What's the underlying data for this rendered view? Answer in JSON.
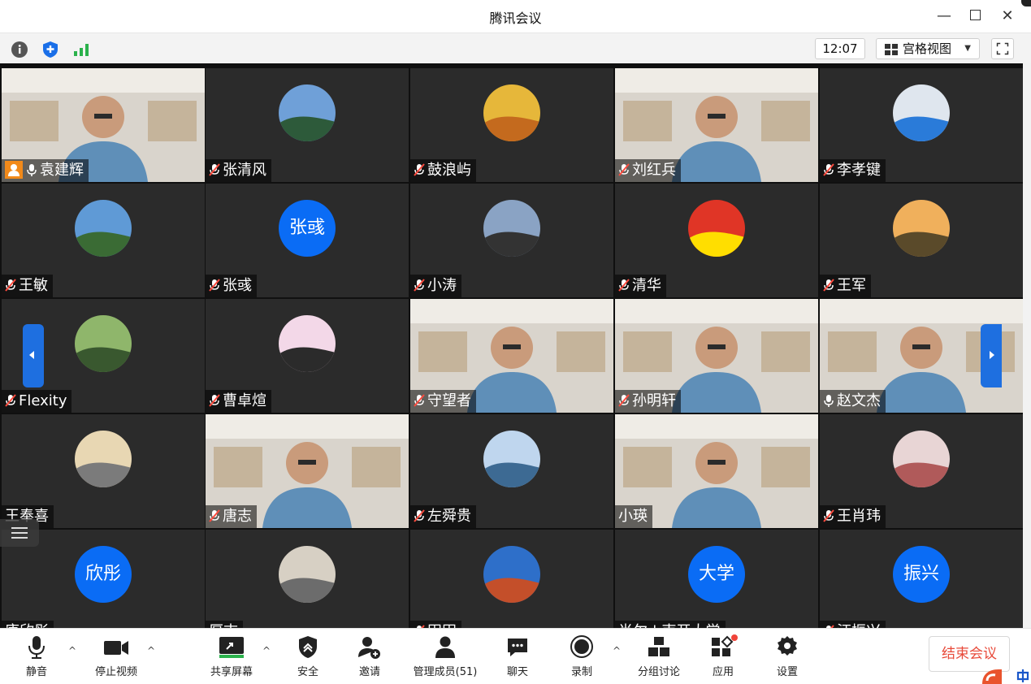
{
  "window": {
    "title": "腾讯会议",
    "minimize": "—",
    "close": "✕"
  },
  "infobar": {
    "time": "12:07",
    "view_label": "宫格视图",
    "view_caret": "▼"
  },
  "participants": [
    {
      "name": "袁建辉",
      "kind": "video",
      "mic": "on",
      "host": true
    },
    {
      "name": "张清风",
      "kind": "photo",
      "mic": "muted"
    },
    {
      "name": "鼓浪屿",
      "kind": "photo",
      "mic": "muted"
    },
    {
      "name": "刘红兵",
      "kind": "video",
      "mic": "muted"
    },
    {
      "name": "李孝键",
      "kind": "photo",
      "mic": "muted"
    },
    {
      "name": "王敏",
      "kind": "photo",
      "mic": "muted"
    },
    {
      "name": "张彧",
      "kind": "text",
      "avatar_text": "张彧",
      "mic": "muted"
    },
    {
      "name": "小涛",
      "kind": "photo",
      "mic": "muted"
    },
    {
      "name": "清华",
      "kind": "photo",
      "mic": "muted"
    },
    {
      "name": "王军",
      "kind": "photo",
      "mic": "muted"
    },
    {
      "name": "Flexity",
      "kind": "photo",
      "mic": "muted"
    },
    {
      "name": "曹卓煊",
      "kind": "photo",
      "mic": "muted"
    },
    {
      "name": "守望者",
      "kind": "video",
      "mic": "muted"
    },
    {
      "name": "孙明轩",
      "kind": "video",
      "mic": "muted"
    },
    {
      "name": "赵文杰",
      "kind": "video",
      "mic": "on",
      "active": true
    },
    {
      "name": "王奉喜",
      "kind": "photo",
      "mic": "none"
    },
    {
      "name": "唐志",
      "kind": "video",
      "mic": "muted"
    },
    {
      "name": "左舜贵",
      "kind": "photo",
      "mic": "muted"
    },
    {
      "name": "小瑛",
      "kind": "video",
      "mic": "none"
    },
    {
      "name": "王肖玮",
      "kind": "photo",
      "mic": "muted"
    },
    {
      "name": "康欣彤",
      "kind": "text",
      "avatar_text": "欣彤",
      "mic": "none"
    },
    {
      "name": "厚志",
      "kind": "photo",
      "mic": "none"
    },
    {
      "name": "田田",
      "kind": "photo",
      "mic": "muted"
    },
    {
      "name": "肖尔 | 南开大学",
      "kind": "text",
      "avatar_text": "大学",
      "mic": "none"
    },
    {
      "name": "汪振兴",
      "kind": "text",
      "avatar_text": "振兴",
      "mic": "muted"
    }
  ],
  "toolbar": {
    "mute": "静音",
    "stop_video": "停止视频",
    "share_screen": "共享屏幕",
    "security": "安全",
    "invite": "邀请",
    "manage_members": "管理成员(51)",
    "chat": "聊天",
    "record": "录制",
    "breakout": "分组讨论",
    "apps": "应用",
    "settings": "设置",
    "end_meeting": "结束会议",
    "caret": "^"
  },
  "colors": {
    "accent": "#0a6cf5",
    "active_border": "#2ec15f",
    "end_red": "#e84a3a",
    "tile_bg": "#2b2b2b"
  }
}
